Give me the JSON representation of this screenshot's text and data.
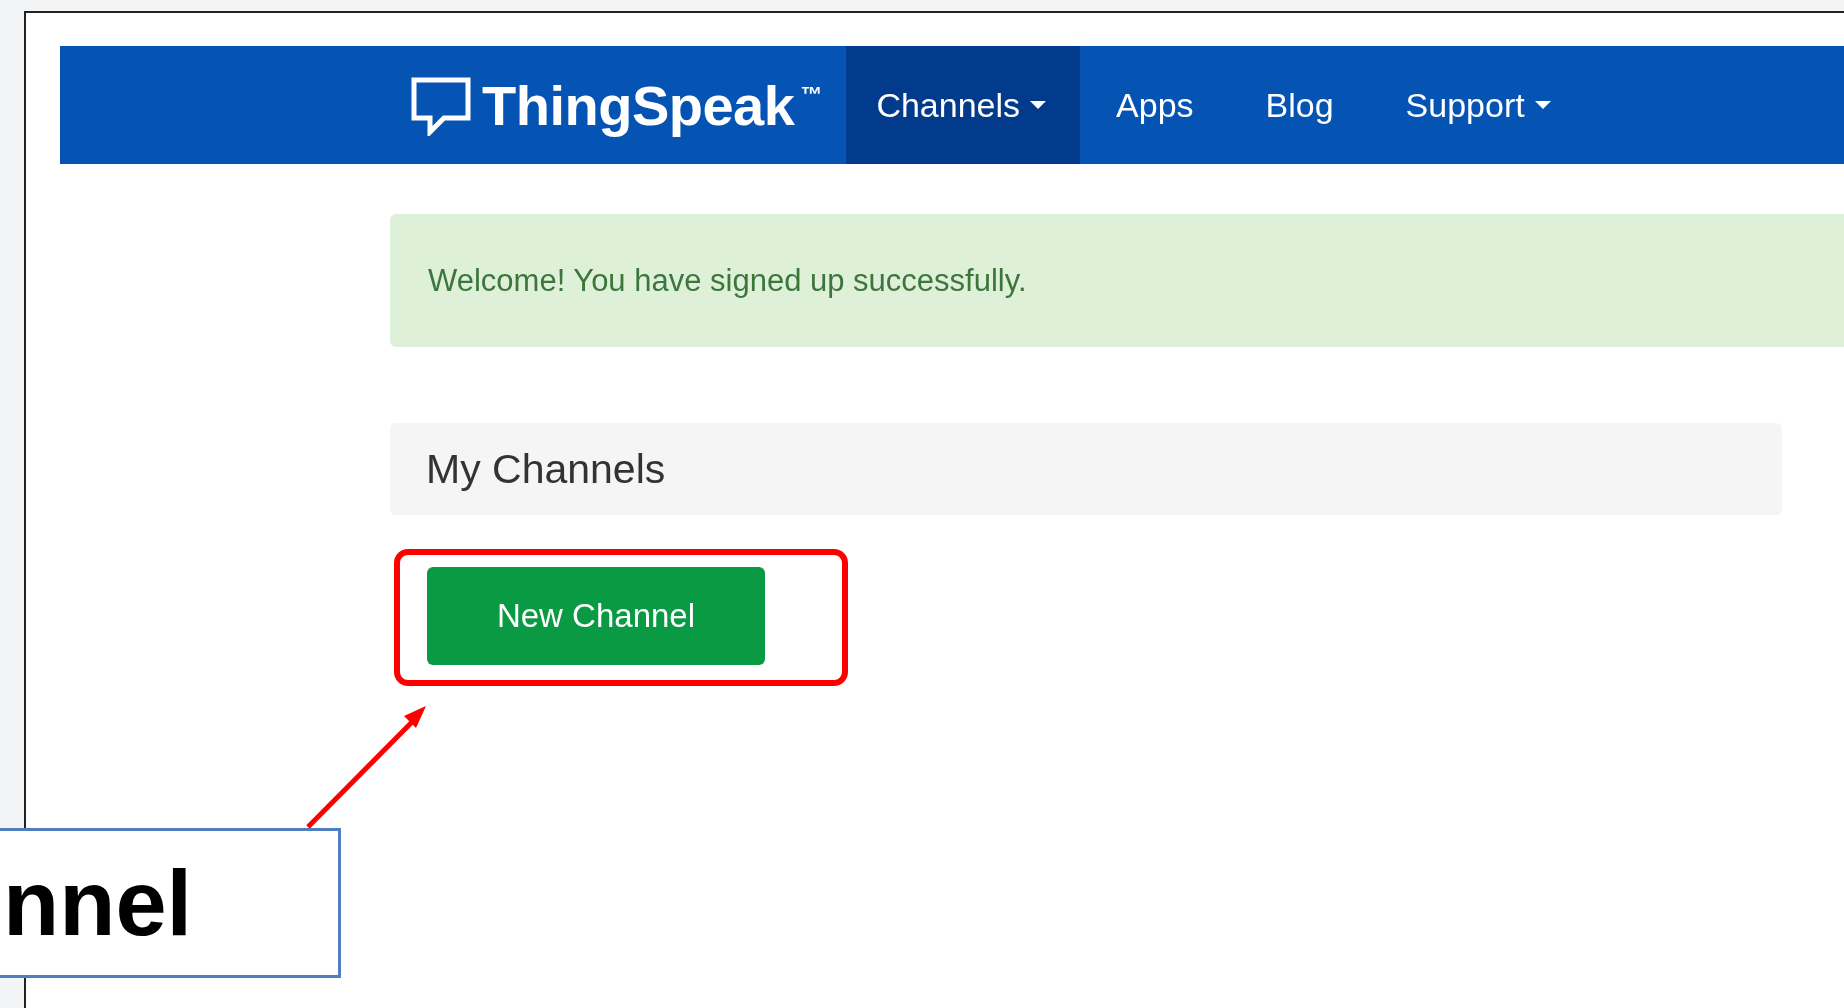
{
  "navbar": {
    "brand": "ThingSpeak",
    "trademark": "™",
    "items": [
      {
        "label": "Channels",
        "dropdown": true,
        "selected": true
      },
      {
        "label": "Apps",
        "dropdown": false,
        "selected": false
      },
      {
        "label": "Blog",
        "dropdown": false,
        "selected": false
      },
      {
        "label": "Support",
        "dropdown": true,
        "selected": false
      }
    ]
  },
  "alert": {
    "message": "Welcome! You have signed up successfully."
  },
  "panel": {
    "title": "My Channels"
  },
  "new_channel_button": {
    "label": "New Channel"
  },
  "callout": {
    "text": "nnel"
  }
}
